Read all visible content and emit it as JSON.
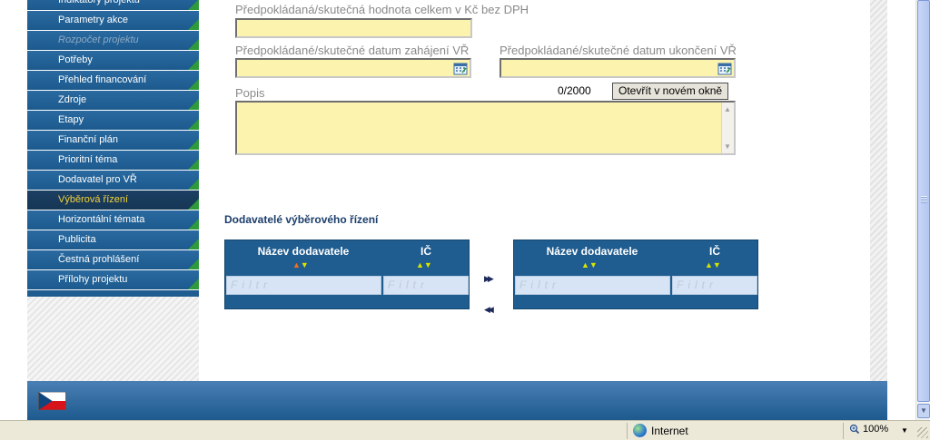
{
  "sidebar": {
    "items": [
      {
        "label": "Indikátory projektu",
        "state": "normal"
      },
      {
        "label": "Parametry akce",
        "state": "normal"
      },
      {
        "label": "Rozpočet projektu",
        "state": "disabled"
      },
      {
        "label": "Potřeby",
        "state": "normal"
      },
      {
        "label": "Přehled financování",
        "state": "normal"
      },
      {
        "label": "Zdroje",
        "state": "normal"
      },
      {
        "label": "Etapy",
        "state": "normal"
      },
      {
        "label": "Finanční plán",
        "state": "normal"
      },
      {
        "label": "Prioritní téma",
        "state": "normal"
      },
      {
        "label": "Dodavatel pro VŘ",
        "state": "normal"
      },
      {
        "label": "Výběrová řízení",
        "state": "active"
      },
      {
        "label": "Horizontální témata",
        "state": "normal"
      },
      {
        "label": "Publicita",
        "state": "normal"
      },
      {
        "label": "Čestná prohlášení",
        "state": "normal"
      },
      {
        "label": "Přílohy projektu",
        "state": "normal"
      }
    ]
  },
  "form": {
    "value_label": "Předpokládaná/skutečná hodnota celkem v Kč bez DPH",
    "value": "",
    "start_label": "Předpokládané/skutečné datum zahájení VŘ",
    "start_value": "",
    "end_label": "Předpokládané/skutečné datum ukončení VŘ",
    "end_value": "",
    "description_label": "Popis",
    "description_counter": "0/2000",
    "open_new_window": "Otevřít v novém okně",
    "description_value": ""
  },
  "suppliers": {
    "section_title": "Dodavatelé výběrového řízení",
    "left_table": {
      "columns": [
        "Název dodavatele",
        "IČ"
      ],
      "filter_placeholder": "Filtr"
    },
    "right_table": {
      "columns": [
        "Název dodavatele",
        "IČ"
      ],
      "filter_placeholder": "Filtr"
    },
    "move_right_glyph": "▶▶",
    "move_left_glyph": "◀◀"
  },
  "statusbar": {
    "zone": "Internet",
    "zoom": "100%"
  },
  "colors": {
    "nav_blue": "#1f5c8f",
    "nav_active_text": "#f2d23b",
    "field_yellow": "#fcf4ae",
    "section_title": "#1c3e6b"
  },
  "icons": {
    "calendar": "calendar-icon",
    "flag": "czech-flag-icon",
    "globe": "internet-zone-icon",
    "zoom": "zoom-icon"
  }
}
